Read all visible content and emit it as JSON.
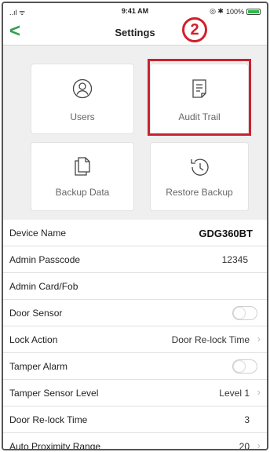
{
  "status": {
    "signal": "..ıl ᯤ",
    "time": "9:41 AM",
    "icons": "◎ ✱",
    "battery_pct": "100%",
    "battery_level": 1.0
  },
  "nav": {
    "back": "<",
    "title": "Settings"
  },
  "annotation": {
    "step": "2"
  },
  "tiles": {
    "users": {
      "label": "Users",
      "icon": "user-circle-icon"
    },
    "audit_trail": {
      "label": "Audit Trail",
      "icon": "document-icon"
    },
    "backup_data": {
      "label": "Backup Data",
      "icon": "copy-documents-icon"
    },
    "restore_backup": {
      "label": "Restore Backup",
      "icon": "history-clock-icon"
    }
  },
  "settings": [
    {
      "label": "Device Name",
      "value": "GDG360BT"
    },
    {
      "label": "Admin Passcode",
      "value": "12345"
    },
    {
      "label": "Admin Card/Fob",
      "value": ""
    },
    {
      "label": "Door Sensor",
      "toggle": false
    },
    {
      "label": "Lock Action",
      "value": "Door Re-lock Time"
    },
    {
      "label": "Tamper Alarm",
      "toggle": false
    },
    {
      "label": "Tamper Sensor Level",
      "value": "Level 1"
    },
    {
      "label": "Door Re-lock Time",
      "value": "3"
    },
    {
      "label": "Auto Proximity Range",
      "value": "20"
    }
  ],
  "colors": {
    "accent": "#2fa04a",
    "highlight": "#c8222e"
  }
}
